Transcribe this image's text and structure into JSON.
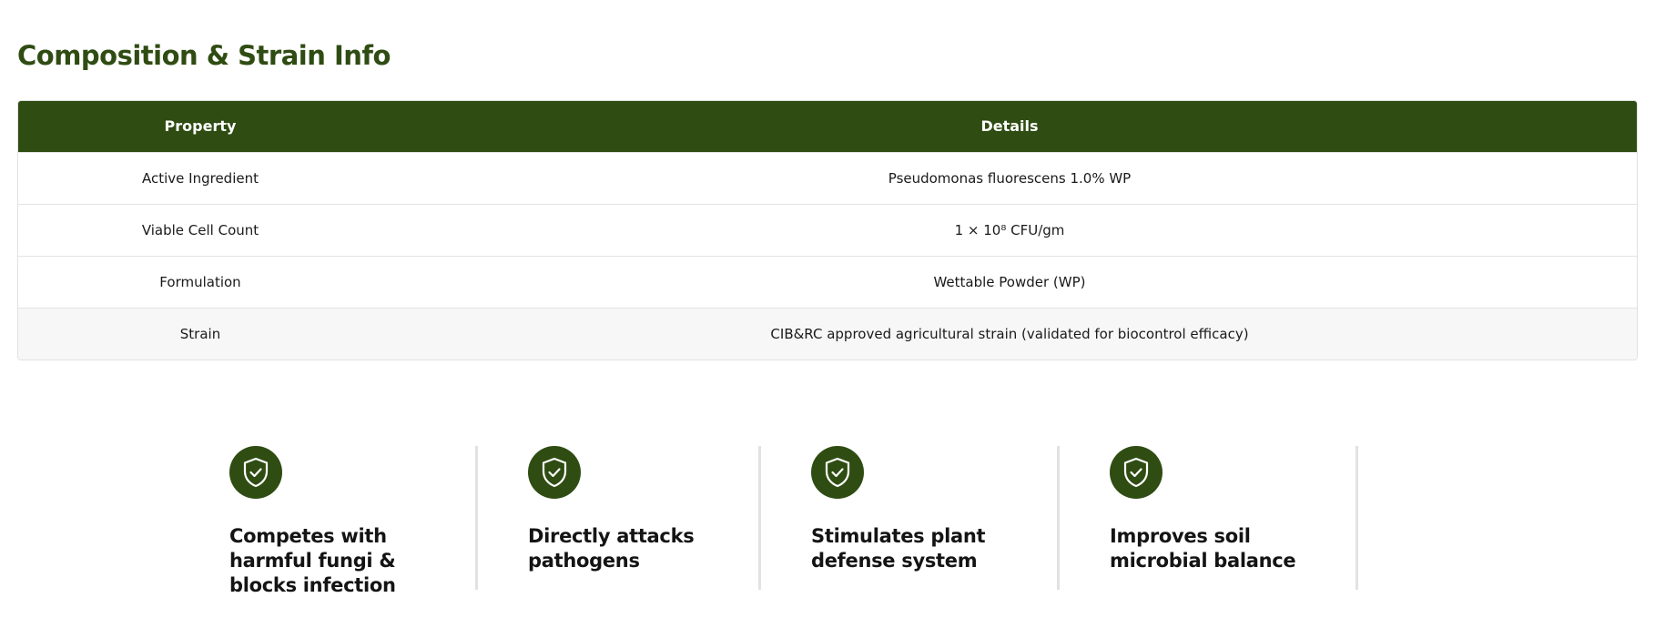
{
  "section": {
    "title": "Composition & Strain Info"
  },
  "table": {
    "headers": [
      "Property",
      "Details"
    ],
    "rows": [
      {
        "property": "Active Ingredient",
        "details": "Pseudomonas fluorescens 1.0% WP"
      },
      {
        "property": "Viable Cell Count",
        "details": "1 × 10⁸ CFU/gm"
      },
      {
        "property": "Formulation",
        "details": "Wettable Powder (WP)"
      },
      {
        "property": "Strain",
        "details": "CIB&RC approved agricultural strain (validated for biocontrol efficacy)"
      }
    ]
  },
  "features": [
    {
      "icon": "shield-check-icon",
      "text": "Competes with harmful fungi & blocks infection"
    },
    {
      "icon": "shield-check-icon",
      "text": "Directly attacks pathogens"
    },
    {
      "icon": "shield-check-icon",
      "text": "Stimulates plant defense system"
    },
    {
      "icon": "shield-check-icon",
      "text": "Improves soil microbial balance"
    }
  ],
  "colors": {
    "brand_green": "#2f4c12",
    "row_shade": "#f7f7f7",
    "divider": "#e2e2e2"
  }
}
